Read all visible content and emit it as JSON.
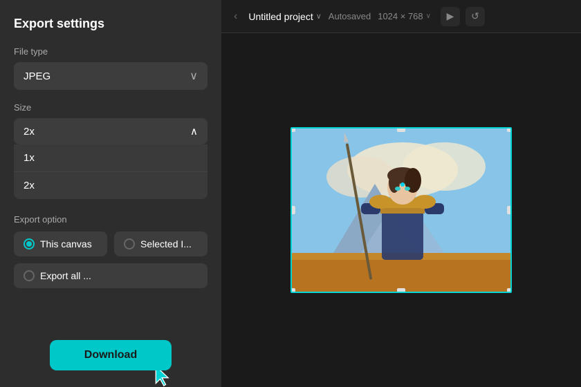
{
  "panel": {
    "title": "Export settings",
    "file_type_label": "File type",
    "file_type_value": "JPEG",
    "size_label": "Size",
    "size_value": "2x",
    "size_options": [
      "1x",
      "2x"
    ],
    "export_option_label": "Export option",
    "export_options": [
      {
        "id": "this-canvas",
        "label": "This canvas",
        "selected": true
      },
      {
        "id": "selected",
        "label": "Selected I...",
        "selected": false
      },
      {
        "id": "export-all",
        "label": "Export all ...",
        "selected": false
      }
    ],
    "download_label": "Download"
  },
  "topbar": {
    "back_arrow": "‹",
    "project_name": "Untitled project",
    "project_dropdown": "∨",
    "autosaved": "Autosaved",
    "dimensions": "1024 × 768",
    "dim_dropdown": "∨"
  }
}
